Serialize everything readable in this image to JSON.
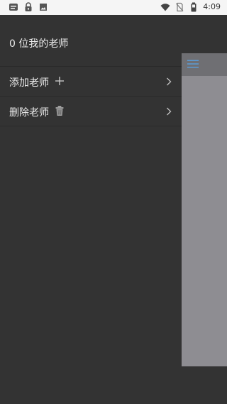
{
  "status_bar": {
    "time": "4:09",
    "left_icons": [
      "message-icon",
      "lock-icon",
      "photo-icon"
    ],
    "right_icons": [
      "wifi-icon",
      "no-sim-icon",
      "battery-icon"
    ]
  },
  "drawer": {
    "title": "0 位我的老师",
    "items": [
      {
        "label": "添加老师",
        "icon": "plus-icon"
      },
      {
        "label": "删除老师",
        "icon": "trash-icon"
      }
    ]
  },
  "colors": {
    "drawer_bg": "#333333",
    "text": "#ececec",
    "main_bg": "#8e8d92",
    "accent": "#5b9bd5"
  }
}
